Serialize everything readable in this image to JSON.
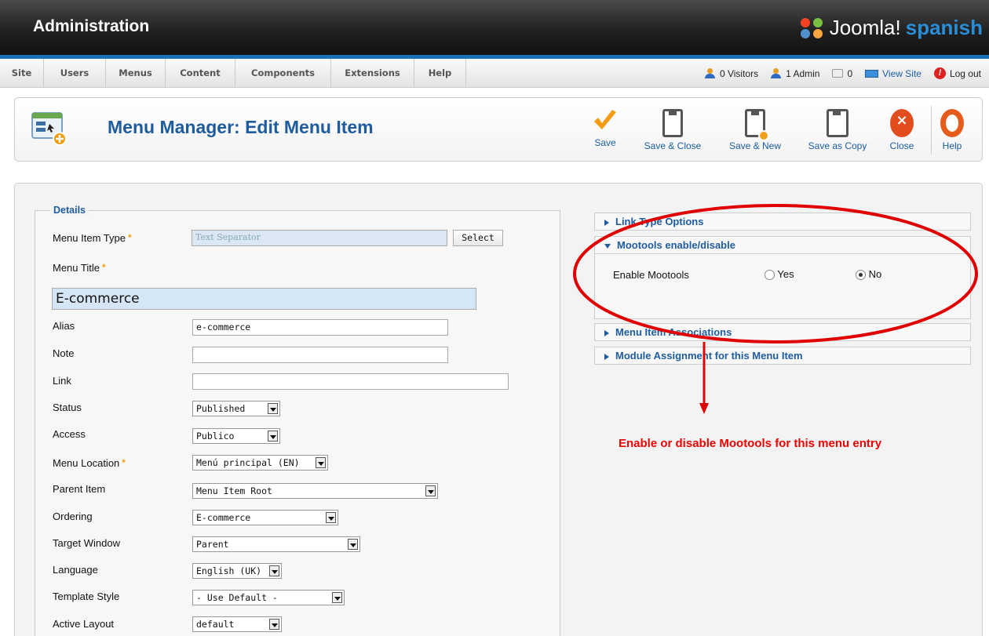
{
  "header": {
    "title": "Administration",
    "logo_word": "Joomla!",
    "logo_suffix": "spanish"
  },
  "menu": [
    "Site",
    "Users",
    "Menus",
    "Content",
    "Components",
    "Extensions",
    "Help"
  ],
  "status": {
    "visitors": "0 Visitors",
    "admins": "1 Admin",
    "messages": "0",
    "view_site": "View Site",
    "logout": "Log out"
  },
  "page_title": "Menu Manager: Edit Menu Item",
  "toolbar": {
    "save": "Save",
    "save_close": "Save & Close",
    "save_new": "Save & New",
    "save_copy": "Save as Copy",
    "close": "Close",
    "help": "Help"
  },
  "details": {
    "legend": "Details",
    "menu_item_type": {
      "label": "Menu Item Type",
      "value": "Text Separator",
      "button": "Select"
    },
    "menu_title": {
      "label": "Menu Title",
      "value": "E-commerce"
    },
    "alias": {
      "label": "Alias",
      "value": "e-commerce"
    },
    "note": {
      "label": "Note",
      "value": ""
    },
    "link": {
      "label": "Link",
      "value": ""
    },
    "status": {
      "label": "Status",
      "value": "Published"
    },
    "access": {
      "label": "Access",
      "value": "Publico"
    },
    "menu_location": {
      "label": "Menu Location",
      "value": "Menú principal (EN)"
    },
    "parent_item": {
      "label": "Parent Item",
      "value": "Menu Item Root"
    },
    "ordering": {
      "label": "Ordering",
      "value": "E-commerce"
    },
    "target_window": {
      "label": "Target Window",
      "value": "Parent"
    },
    "language": {
      "label": "Language",
      "value": "English (UK)"
    },
    "template_style": {
      "label": "Template Style",
      "value": "- Use Default -"
    },
    "active_layout": {
      "label": "Active Layout",
      "value": "default"
    },
    "required_mark": "*"
  },
  "panels": {
    "link_type": "Link Type Options",
    "mootools": "Mootools enable/disable",
    "enable_label": "Enable Mootools",
    "yes": "Yes",
    "no": "No",
    "selected": "No",
    "associations": "Menu Item Associations",
    "module_assignment": "Module Assignment for this Menu Item"
  },
  "annotation": {
    "text": "Enable or disable Mootools for this menu entry",
    "color": "#e00000"
  },
  "colors": {
    "title_blue": "#1e5c9e",
    "link_blue": "#1b5ea7",
    "header_dark": "#1e1e1e",
    "strip_blue": "#1b71b8"
  }
}
